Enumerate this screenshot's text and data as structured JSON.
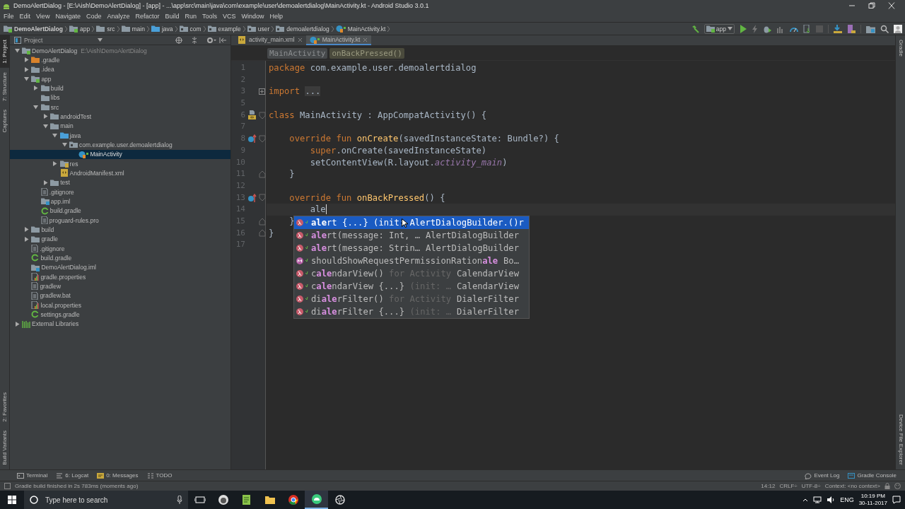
{
  "window": {
    "title": "DemoAlertDialog - [E:\\Aish\\DemoAlertDialog] - [app] - ...\\app\\src\\main\\java\\com\\example\\user\\demoalertdialog\\MainActivity.kt - Android Studio 3.0.1"
  },
  "menu": [
    "File",
    "Edit",
    "View",
    "Navigate",
    "Code",
    "Analyze",
    "Refactor",
    "Build",
    "Run",
    "Tools",
    "VCS",
    "Window",
    "Help"
  ],
  "breadcrumbs": [
    {
      "label": "DemoAlertDialog",
      "kind": "module"
    },
    {
      "label": "app",
      "kind": "module"
    },
    {
      "label": "src",
      "kind": "folder"
    },
    {
      "label": "main",
      "kind": "folder"
    },
    {
      "label": "java",
      "kind": "source"
    },
    {
      "label": "com",
      "kind": "package"
    },
    {
      "label": "example",
      "kind": "package"
    },
    {
      "label": "user",
      "kind": "package"
    },
    {
      "label": "demoalertdialog",
      "kind": "package"
    },
    {
      "label": "MainActivity.kt",
      "kind": "kotlin"
    }
  ],
  "toolbar": {
    "configuration": "app"
  },
  "left_tool_tabs": {
    "top": [
      {
        "label": "1: Project",
        "selected": true
      },
      {
        "label": "7: Structure",
        "selected": false
      },
      {
        "label": "Captures",
        "selected": false
      }
    ],
    "bottom": [
      {
        "label": "2: Favorites",
        "selected": false
      },
      {
        "label": "Build Variants",
        "selected": false
      }
    ]
  },
  "right_tool_tabs": {
    "top": [
      {
        "label": "Gradle"
      }
    ],
    "bottom": [
      {
        "label": "Device File Explorer"
      }
    ]
  },
  "project_panel": {
    "view": "Project",
    "tree": [
      {
        "label": "DemoAlertDialog",
        "location": "E:\\Aish\\DemoAlertDialog",
        "kind": "module",
        "expanded": true,
        "selected": false,
        "children": [
          {
            "label": ".gradle",
            "kind": "excluded",
            "expanded": false,
            "selected": false
          },
          {
            "label": ".idea",
            "kind": "folder",
            "expanded": false,
            "selected": false
          },
          {
            "label": "app",
            "kind": "module",
            "expanded": true,
            "selected": false,
            "children": [
              {
                "label": "build",
                "kind": "folder",
                "expanded": false,
                "selected": false
              },
              {
                "label": "libs",
                "kind": "folder",
                "selected": false
              },
              {
                "label": "src",
                "kind": "folder",
                "expanded": true,
                "selected": false,
                "children": [
                  {
                    "label": "androidTest",
                    "kind": "folder",
                    "expanded": false,
                    "selected": false
                  },
                  {
                    "label": "main",
                    "kind": "folder",
                    "expanded": true,
                    "selected": false,
                    "children": [
                      {
                        "label": "java",
                        "kind": "source",
                        "expanded": true,
                        "selected": false,
                        "children": [
                          {
                            "label": "com.example.user.demoalertdialog",
                            "kind": "package",
                            "expanded": true,
                            "selected": false,
                            "children": [
                              {
                                "label": "MainActivity",
                                "kind": "kotlin",
                                "selected": true
                              }
                            ]
                          }
                        ]
                      },
                      {
                        "label": "res",
                        "kind": "resources",
                        "expanded": false,
                        "selected": false
                      },
                      {
                        "label": "AndroidManifest.xml",
                        "kind": "manifest",
                        "selected": false
                      }
                    ]
                  },
                  {
                    "label": "test",
                    "kind": "folder",
                    "expanded": false,
                    "selected": false
                  }
                ]
              },
              {
                "label": ".gitignore",
                "kind": "file",
                "selected": false
              },
              {
                "label": "app.iml",
                "kind": "iml",
                "selected": false
              },
              {
                "label": "build.gradle",
                "kind": "gradle",
                "selected": false
              },
              {
                "label": "proguard-rules.pro",
                "kind": "file",
                "selected": false
              }
            ]
          },
          {
            "label": "build",
            "kind": "folder",
            "expanded": false,
            "selected": false
          },
          {
            "label": "gradle",
            "kind": "folder",
            "expanded": false,
            "selected": false
          },
          {
            "label": ".gitignore",
            "kind": "file",
            "selected": false
          },
          {
            "label": "build.gradle",
            "kind": "gradle",
            "selected": false
          },
          {
            "label": "DemoAlertDialog.iml",
            "kind": "iml",
            "selected": false
          },
          {
            "label": "gradle.properties",
            "kind": "properties",
            "selected": false
          },
          {
            "label": "gradlew",
            "kind": "file",
            "selected": false
          },
          {
            "label": "gradlew.bat",
            "kind": "file",
            "selected": false
          },
          {
            "label": "local.properties",
            "kind": "properties",
            "selected": false
          },
          {
            "label": "settings.gradle",
            "kind": "gradle",
            "selected": false
          }
        ]
      },
      {
        "label": "External Libraries",
        "kind": "libraries",
        "expanded": false,
        "selected": false
      }
    ]
  },
  "editor": {
    "tabs": [
      {
        "label": "activity_main.xml",
        "kind": "xml",
        "selected": false
      },
      {
        "label": "MainActivity.kt",
        "kind": "kotlin",
        "selected": true
      }
    ],
    "breadcrumb": [
      {
        "label": "MainActivity",
        "kind": "class"
      },
      {
        "label": "onBackPressed()",
        "kind": "function"
      }
    ],
    "lines": [
      {
        "number": "1",
        "current": false,
        "tokens": [
          {
            "text": "package",
            "kind": "keyword"
          },
          {
            "text": " com.example.user.demoalertdialog",
            "kind": "plain"
          }
        ]
      },
      {
        "number": "2",
        "current": false
      },
      {
        "number": "3",
        "current": false,
        "fold": {
          "kind": "collapsed"
        },
        "tokens": [
          {
            "text": "import ",
            "kind": "keyword"
          },
          {
            "text": "...",
            "kind": "folded"
          }
        ]
      },
      {
        "number": "5",
        "current": false
      },
      {
        "number": "6",
        "current": false,
        "marker": {
          "kind": "layout"
        },
        "fold": {
          "kind": "start"
        },
        "tokens": [
          {
            "text": "class",
            "kind": "keyword"
          },
          {
            "text": " MainActivity : AppCompatActivity() {",
            "kind": "plain"
          }
        ]
      },
      {
        "number": "7",
        "current": false
      },
      {
        "number": "8",
        "current": false,
        "marker": {
          "kind": "override"
        },
        "fold": {
          "kind": "start"
        },
        "tokens": [
          {
            "text": "    override fun ",
            "kind": "keyword"
          },
          {
            "text": "onCreate",
            "kind": "function"
          },
          {
            "text": "(savedInstanceState: Bundle?) {",
            "kind": "plain"
          }
        ]
      },
      {
        "number": "9",
        "current": false,
        "tokens": [
          {
            "text": "        super",
            "kind": "keyword"
          },
          {
            "text": ".onCreate(savedInstanceState)",
            "kind": "plain"
          }
        ]
      },
      {
        "number": "10",
        "current": false,
        "tokens": [
          {
            "text": "        setContentView(R.layout.",
            "kind": "plain"
          },
          {
            "text": "activity_main",
            "kind": "field"
          },
          {
            "text": ")",
            "kind": "plain"
          }
        ]
      },
      {
        "number": "11",
        "current": false,
        "fold": {
          "kind": "end"
        },
        "tokens": [
          {
            "text": "    }",
            "kind": "plain"
          }
        ]
      },
      {
        "number": "12",
        "current": false
      },
      {
        "number": "13",
        "current": false,
        "marker": {
          "kind": "override"
        },
        "fold": {
          "kind": "start"
        },
        "tokens": [
          {
            "text": "    override fun ",
            "kind": "keyword"
          },
          {
            "text": "onBackPressed",
            "kind": "function"
          },
          {
            "text": "() {",
            "kind": "plain"
          }
        ]
      },
      {
        "number": "14",
        "current": true,
        "tokens": [
          {
            "text": "        ale",
            "kind": "plain"
          }
        ]
      },
      {
        "number": "15",
        "current": false,
        "fold": {
          "kind": "end"
        },
        "tokens": [
          {
            "text": "    }",
            "kind": "plain"
          }
        ]
      },
      {
        "number": "16",
        "current": false,
        "fold": {
          "kind": "end"
        },
        "tokens": [
          {
            "text": "}",
            "kind": "plain"
          }
        ]
      },
      {
        "number": "17",
        "current": false
      }
    ],
    "completion": [
      {
        "kind": "lambda",
        "selected": true,
        "name": "**ale**rt",
        "params": " {...} ",
        "hint": "(init: AlertDialogBuilder.()",
        "type": "r"
      },
      {
        "kind": "lambda",
        "selected": false,
        "name": "**ale**rt",
        "params": "(message: Int, …",
        "type": "AlertDialogBuilder"
      },
      {
        "kind": "lambda",
        "selected": false,
        "name": "**ale**rt",
        "params": "(message: Strin…",
        "type": "AlertDialogBuilder"
      },
      {
        "kind": "method",
        "selected": false,
        "name": "shouldShowRequestPermissionRation**ale**",
        "type": "Bo…"
      },
      {
        "kind": "lambda",
        "selected": false,
        "name": "c**ale**ndarView",
        "params": "() ",
        "hint": "for Activity",
        "type": "CalendarView"
      },
      {
        "kind": "lambda",
        "selected": false,
        "name": "c**ale**ndarView",
        "params": " {...} ",
        "hint": "(init: …",
        "type": "CalendarView"
      },
      {
        "kind": "lambda",
        "selected": false,
        "name": "di**ale**rFilter",
        "params": "() ",
        "hint": "for Activity",
        "type": "DialerFilter"
      },
      {
        "kind": "lambda",
        "selected": false,
        "name": "di**ale**rFilter",
        "params": " {...} ",
        "hint": "(init: …",
        "type": "DialerFilter"
      }
    ]
  },
  "bottom_tool_tabs": {
    "left": [
      {
        "label": "Terminal",
        "kind": "terminal"
      },
      {
        "label": "6: Logcat",
        "kind": "logcat"
      },
      {
        "label": "0: Messages",
        "kind": "messages"
      },
      {
        "label": "TODO",
        "kind": "todo"
      }
    ],
    "right": [
      {
        "label": "Event Log",
        "kind": "eventlog"
      },
      {
        "label": "Gradle Console",
        "kind": "console"
      }
    ]
  },
  "status_bar": {
    "message": "Gradle build finished in 2s 783ms (moments ago)",
    "position": "14:12",
    "line_separator": "CRLF÷",
    "encoding": "UTF-8÷",
    "context": "Context: <no context>"
  },
  "taskbar": {
    "search": {
      "placeholder": "Type here to search"
    },
    "language": "ENG",
    "time": "10:19 PM",
    "date": "30-11-2017"
  }
}
